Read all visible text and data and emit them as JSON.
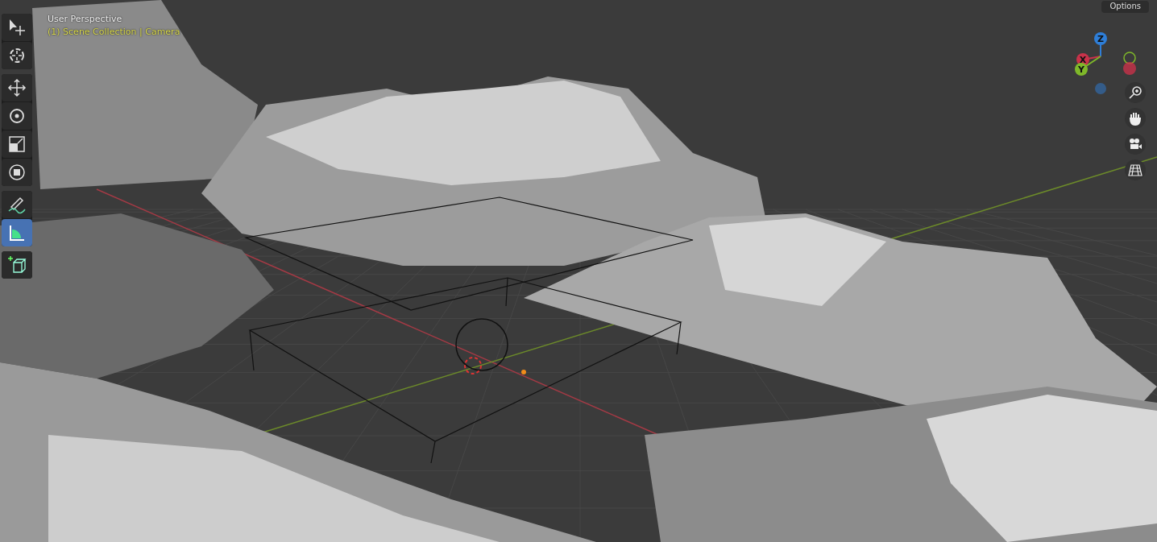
{
  "viewport": {
    "view_name": "User Perspective",
    "context": "(1) Scene Collection | Camera",
    "options_button": "Options"
  },
  "toolbar": {
    "groups": [
      [
        {
          "kind": "select",
          "selected": false
        },
        {
          "kind": "cursor",
          "selected": false
        }
      ],
      [
        {
          "kind": "move",
          "selected": false
        },
        {
          "kind": "rotate",
          "selected": false
        },
        {
          "kind": "scale",
          "selected": false
        },
        {
          "kind": "transform",
          "selected": false
        }
      ],
      [
        {
          "kind": "annotate",
          "selected": false
        },
        {
          "kind": "measure",
          "selected": true
        }
      ],
      [
        {
          "kind": "add-cube",
          "selected": false
        }
      ]
    ]
  },
  "gizmo": {
    "axes": [
      {
        "label": "Z",
        "color": "#2e7ed8"
      },
      {
        "label": "X",
        "color": "#c8324a"
      },
      {
        "label": "Y",
        "color": "#7fb82a"
      }
    ]
  },
  "navigation": [
    {
      "kind": "zoom"
    },
    {
      "kind": "pan"
    },
    {
      "kind": "camera"
    },
    {
      "kind": "ortho"
    }
  ]
}
